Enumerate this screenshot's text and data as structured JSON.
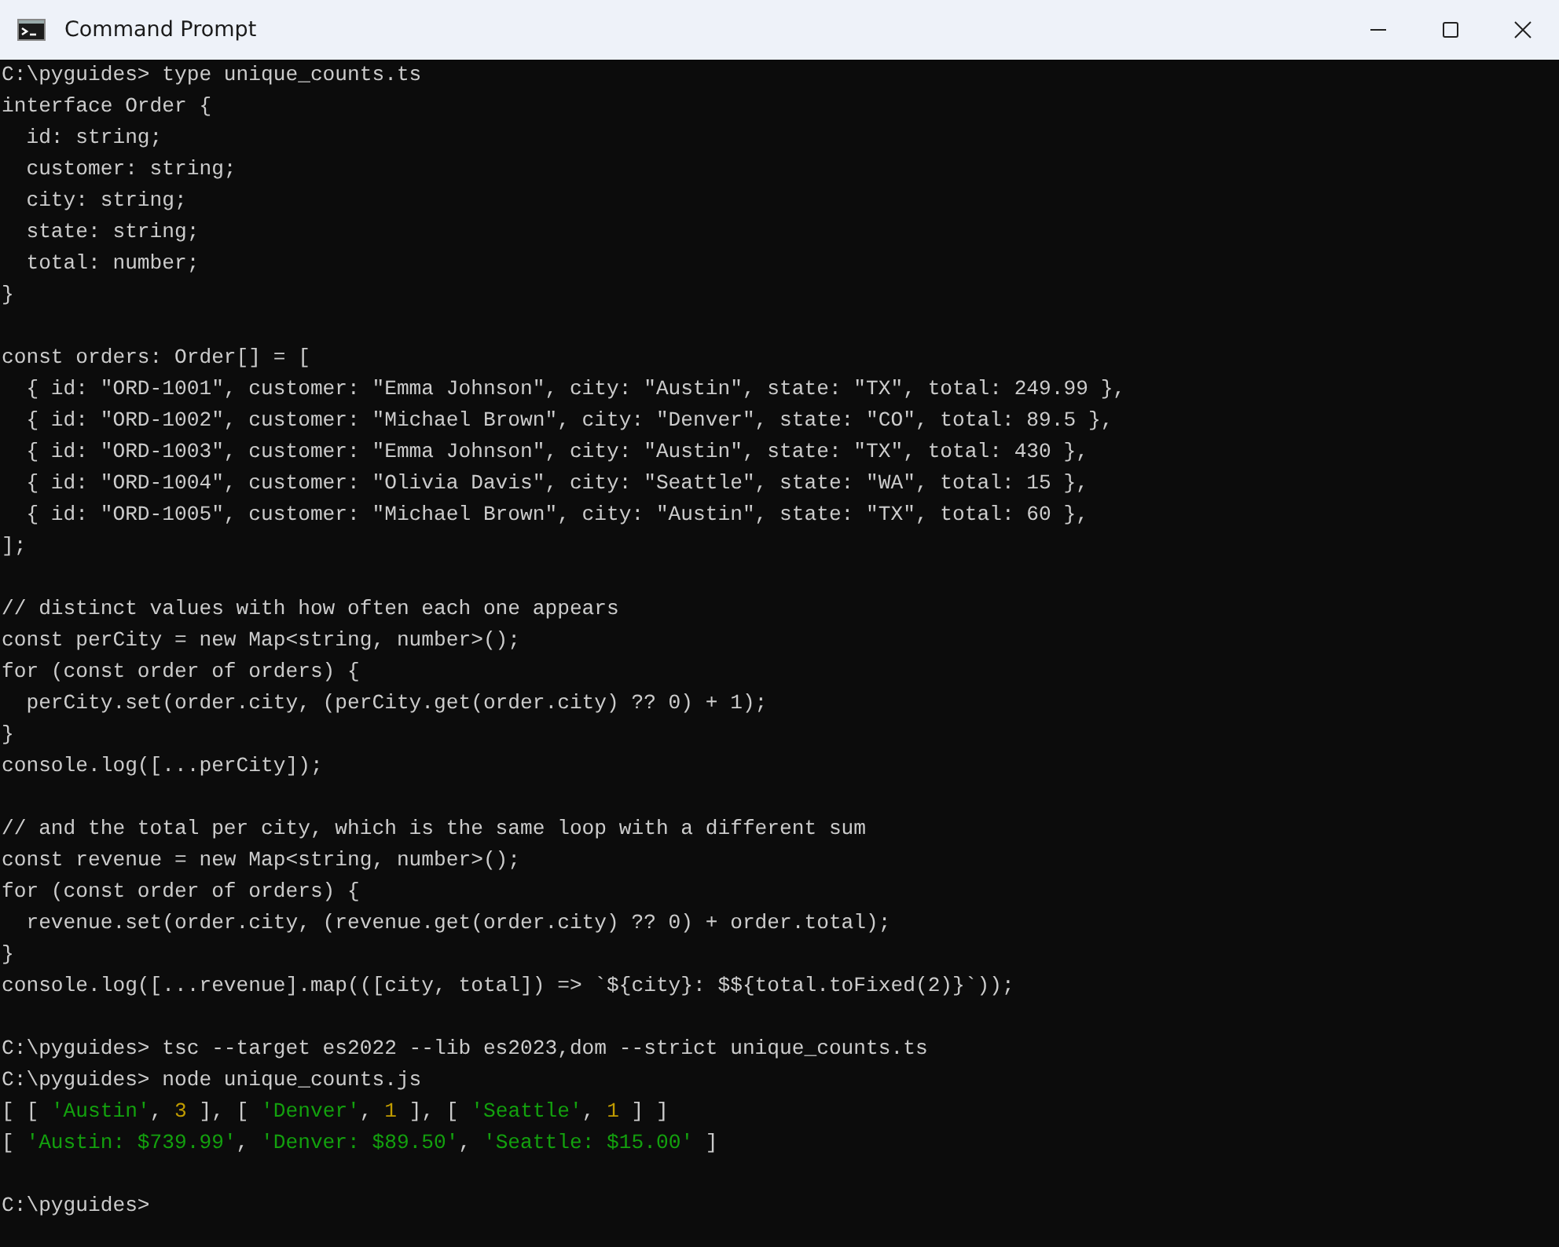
{
  "window": {
    "title": "Command Prompt"
  },
  "console": {
    "lines": [
      {
        "kind": "plain",
        "text": "C:\\pyguides> type unique_counts.ts"
      },
      {
        "kind": "plain",
        "text": "interface Order {"
      },
      {
        "kind": "plain",
        "text": "  id: string;"
      },
      {
        "kind": "plain",
        "text": "  customer: string;"
      },
      {
        "kind": "plain",
        "text": "  city: string;"
      },
      {
        "kind": "plain",
        "text": "  state: string;"
      },
      {
        "kind": "plain",
        "text": "  total: number;"
      },
      {
        "kind": "plain",
        "text": "}"
      },
      {
        "kind": "blank"
      },
      {
        "kind": "plain",
        "text": "const orders: Order[] = ["
      },
      {
        "kind": "plain",
        "text": "  { id: \"ORD-1001\", customer: \"Emma Johnson\", city: \"Austin\", state: \"TX\", total: 249.99 },"
      },
      {
        "kind": "plain",
        "text": "  { id: \"ORD-1002\", customer: \"Michael Brown\", city: \"Denver\", state: \"CO\", total: 89.5 },"
      },
      {
        "kind": "plain",
        "text": "  { id: \"ORD-1003\", customer: \"Emma Johnson\", city: \"Austin\", state: \"TX\", total: 430 },"
      },
      {
        "kind": "plain",
        "text": "  { id: \"ORD-1004\", customer: \"Olivia Davis\", city: \"Seattle\", state: \"WA\", total: 15 },"
      },
      {
        "kind": "plain",
        "text": "  { id: \"ORD-1005\", customer: \"Michael Brown\", city: \"Austin\", state: \"TX\", total: 60 },"
      },
      {
        "kind": "plain",
        "text": "];"
      },
      {
        "kind": "blank"
      },
      {
        "kind": "plain",
        "text": "// distinct values with how often each one appears"
      },
      {
        "kind": "plain",
        "text": "const perCity = new Map<string, number>();"
      },
      {
        "kind": "plain",
        "text": "for (const order of orders) {"
      },
      {
        "kind": "plain",
        "text": "  perCity.set(order.city, (perCity.get(order.city) ?? 0) + 1);"
      },
      {
        "kind": "plain",
        "text": "}"
      },
      {
        "kind": "plain",
        "text": "console.log([...perCity]);"
      },
      {
        "kind": "blank"
      },
      {
        "kind": "plain",
        "text": "// and the total per city, which is the same loop with a different sum"
      },
      {
        "kind": "plain",
        "text": "const revenue = new Map<string, number>();"
      },
      {
        "kind": "plain",
        "text": "for (const order of orders) {"
      },
      {
        "kind": "plain",
        "text": "  revenue.set(order.city, (revenue.get(order.city) ?? 0) + order.total);"
      },
      {
        "kind": "plain",
        "text": "}"
      },
      {
        "kind": "plain",
        "text": "console.log([...revenue].map(([city, total]) => `${city}: $${total.toFixed(2)}`));"
      },
      {
        "kind": "blank"
      },
      {
        "kind": "plain",
        "text": "C:\\pyguides> tsc --target es2022 --lib es2023,dom --strict unique_counts.ts"
      },
      {
        "kind": "plain",
        "text": "C:\\pyguides> node unique_counts.js"
      },
      {
        "kind": "colored",
        "segments": [
          {
            "kind": "plain",
            "text": "[ [ "
          },
          {
            "kind": "string",
            "text": "'Austin'"
          },
          {
            "kind": "plain",
            "text": ", "
          },
          {
            "kind": "number",
            "text": "3"
          },
          {
            "kind": "plain",
            "text": " ], [ "
          },
          {
            "kind": "string",
            "text": "'Denver'"
          },
          {
            "kind": "plain",
            "text": ", "
          },
          {
            "kind": "number",
            "text": "1"
          },
          {
            "kind": "plain",
            "text": " ], [ "
          },
          {
            "kind": "string",
            "text": "'Seattle'"
          },
          {
            "kind": "plain",
            "text": ", "
          },
          {
            "kind": "number",
            "text": "1"
          },
          {
            "kind": "plain",
            "text": " ] ]"
          }
        ]
      },
      {
        "kind": "colored",
        "segments": [
          {
            "kind": "plain",
            "text": "[ "
          },
          {
            "kind": "string",
            "text": "'Austin: $739.99'"
          },
          {
            "kind": "plain",
            "text": ", "
          },
          {
            "kind": "string",
            "text": "'Denver: $89.50'"
          },
          {
            "kind": "plain",
            "text": ", "
          },
          {
            "kind": "string",
            "text": "'Seattle: $15.00'"
          },
          {
            "kind": "plain",
            "text": " ]"
          }
        ]
      },
      {
        "kind": "blank"
      },
      {
        "kind": "plain",
        "text": "C:\\pyguides>"
      }
    ]
  }
}
